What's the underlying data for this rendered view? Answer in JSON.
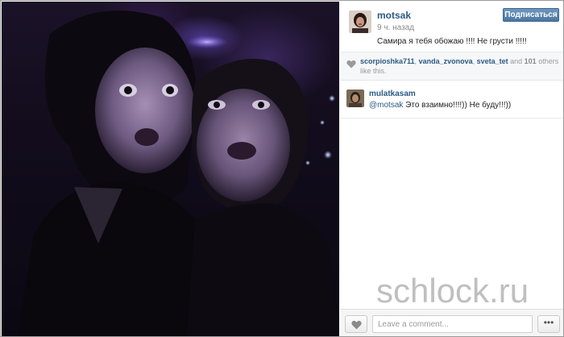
{
  "post": {
    "username": "motsak",
    "time_ago": "9 ч. назад",
    "caption": "Самира я тебя обожаю !!!! Не грусти !!!!!",
    "follow_label": "Подписаться"
  },
  "likes": {
    "users": [
      "scorpioshka711",
      "vanda_zvonova",
      "sveta_tet"
    ],
    "sep1": ", ",
    "sep2": ", ",
    "and_text": " and ",
    "others_count": "101",
    "suffix": " others like this."
  },
  "comments": [
    {
      "username": "mulatkasam",
      "mention": "@motsak",
      "text": " Это взаимно!!!!)) Не буду!!!))"
    }
  ],
  "footer": {
    "comment_placeholder": "Leave a comment...",
    "more_label": "•••"
  },
  "watermark": "schlock.ru",
  "icons": {
    "like": "heart-icon",
    "more": "more-icon"
  },
  "colors": {
    "link": "#2b5a83",
    "follow_button": "#4b77a0"
  }
}
